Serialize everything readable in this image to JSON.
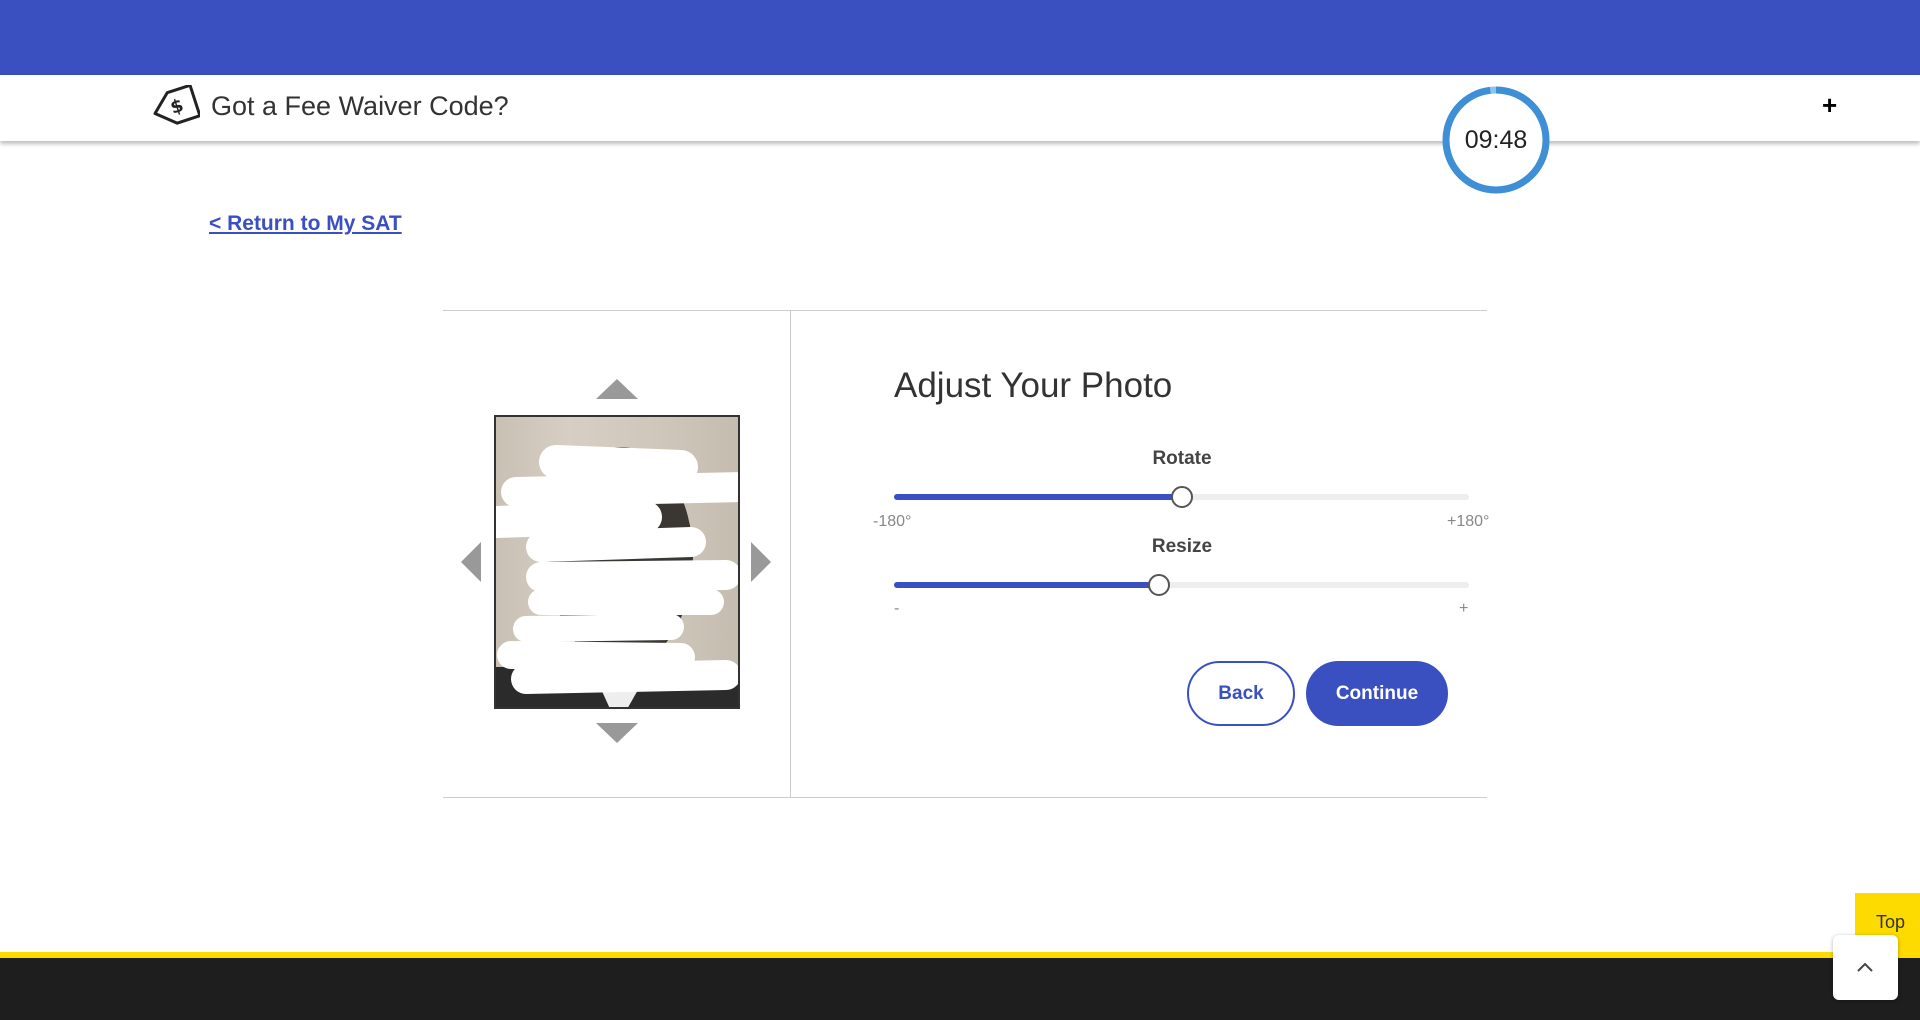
{
  "header": {
    "fee_waiver_text": "Got a Fee Waiver Code?",
    "expand_label": "+",
    "timer": "09:48",
    "timer_progress": 0.98
  },
  "nav": {
    "return_link": "< Return to My SAT"
  },
  "photo_editor": {
    "title": "Adjust Your Photo",
    "rotate": {
      "label": "Rotate",
      "min_label": "-180°",
      "max_label": "+180°",
      "value_fraction": 0.5
    },
    "resize": {
      "label": "Resize",
      "min_label": "-",
      "max_label": "+",
      "value_fraction": 0.46
    },
    "back_label": "Back",
    "continue_label": "Continue"
  },
  "footer": {
    "top_label": "Top"
  },
  "colors": {
    "brand_blue": "#3a4fc0",
    "accent_yellow": "#fedb00",
    "footer_dark": "#1e1e1e"
  }
}
